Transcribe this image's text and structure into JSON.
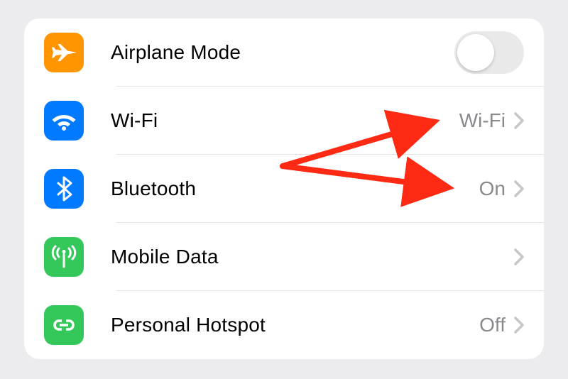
{
  "settings": {
    "airplane": {
      "label": "Airplane Mode",
      "on": false
    },
    "wifi": {
      "label": "Wi-Fi",
      "value": "Wi-Fi"
    },
    "bluetooth": {
      "label": "Bluetooth",
      "value": "On"
    },
    "mobile": {
      "label": "Mobile Data",
      "value": ""
    },
    "hotspot": {
      "label": "Personal Hotspot",
      "value": "Off"
    }
  },
  "colors": {
    "orange": "#ff9500",
    "blue": "#027aff",
    "green": "#34c759",
    "annotation": "#ff2a13"
  }
}
